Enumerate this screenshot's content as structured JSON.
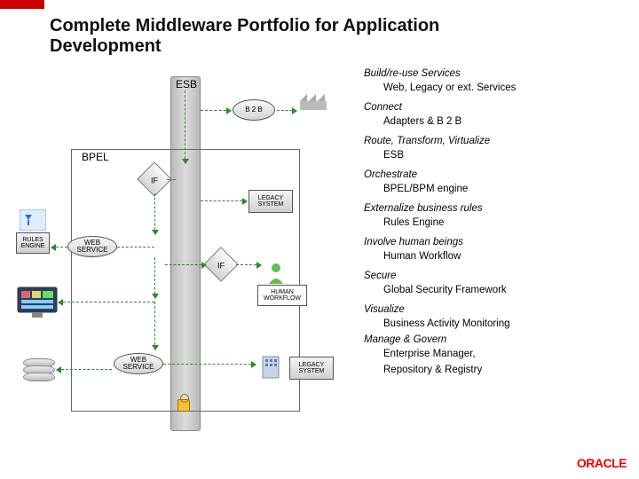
{
  "title": "Complete Middleware Portfolio for Application Development",
  "columns": {
    "esb": "ESB",
    "bpel": "BPEL"
  },
  "nodes": {
    "b2b": "B 2 B",
    "if1": "IF",
    "if2": "IF",
    "legacy1": "LEGACY SYSTEM",
    "legacy2": "LEGACY SYSTEM",
    "humanwf": "HUMAN WORKFLOW",
    "rules": "RULES ENGINE",
    "ws1": "WEB SERVICE",
    "ws2": "WEB SERVICE"
  },
  "sidebar": [
    {
      "head": "Build/re-use Services",
      "sub": "Web, Legacy or ext. Services"
    },
    {
      "head": "Connect",
      "sub": "Adapters & B 2 B"
    },
    {
      "head": "Route, Transform, Virtualize",
      "sub": "ESB"
    },
    {
      "head": "Orchestrate",
      "sub": "BPEL/BPM engine"
    },
    {
      "head": "Externalize business rules",
      "sub": "Rules Engine"
    },
    {
      "head": "Involve human beings",
      "sub": "Human Workflow"
    },
    {
      "head": "Secure",
      "sub": "Global Security Framework"
    },
    {
      "head": "Visualize",
      "sub": "Business Activity Monitoring"
    },
    {
      "head": "Manage & Govern",
      "sub": "Enterprise Manager,"
    },
    {
      "head": "",
      "sub": "Repository & Registry"
    }
  ],
  "brand": "ORACLE"
}
